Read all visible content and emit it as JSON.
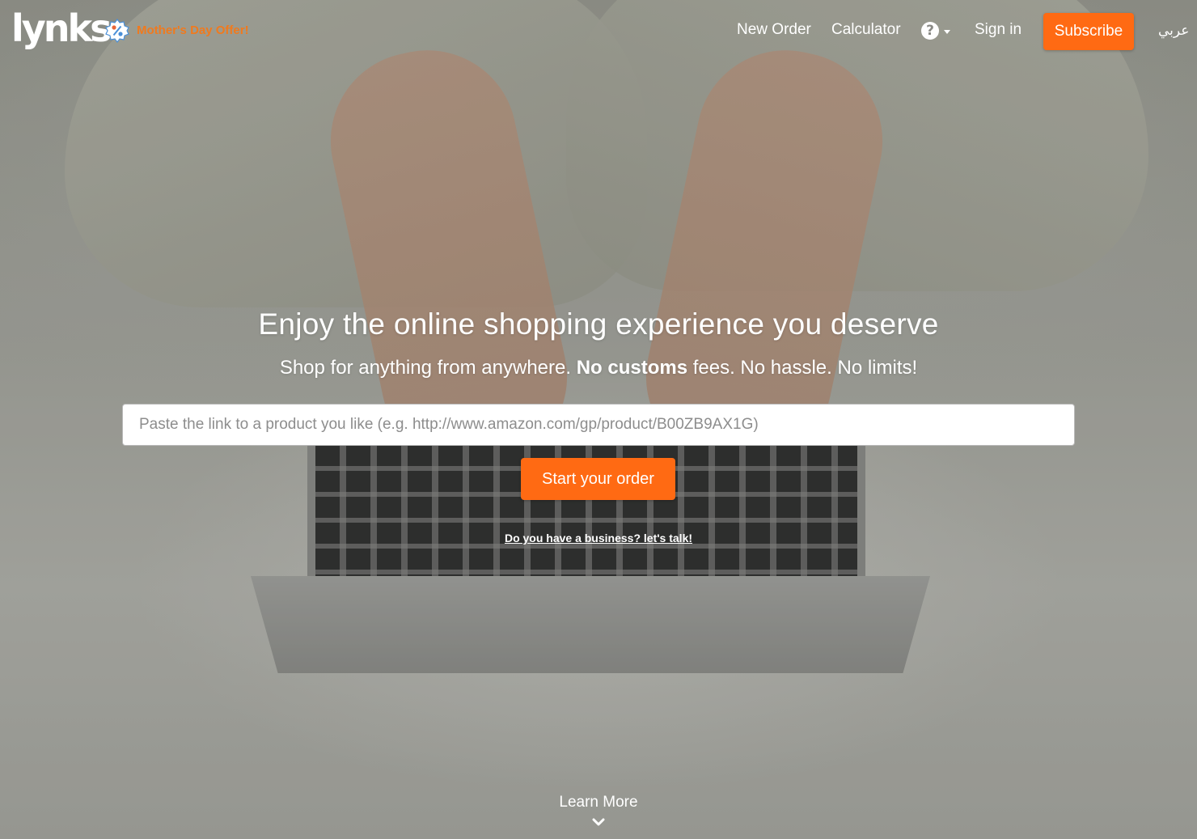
{
  "header": {
    "logo": "lynks",
    "offer_text": "Mother's Day Offer!",
    "offer_icon": "discount-badge-icon",
    "nav": {
      "new_order": "New Order",
      "calculator": "Calculator",
      "help_icon": "question-circle-icon",
      "sign_in": "Sign in",
      "subscribe": "Subscribe",
      "language": "عربي"
    }
  },
  "hero": {
    "headline": "Enjoy the online shopping experience you deserve",
    "subline_part1": "Shop for anything from anywhere. ",
    "subline_bold": "No customs",
    "subline_part2": " fees. No hassle. No limits!",
    "input_placeholder": "Paste the link to a product you like (e.g. http://www.amazon.com/gp/product/B00ZB9AX1G)",
    "input_value": "",
    "start_button": "Start your order",
    "business_link": "Do you have a business? let's talk!",
    "learn_more": "Learn More",
    "learn_more_icon": "chevron-down-icon"
  },
  "colors": {
    "accent": "#ff6a13",
    "offer": "#f07a1e",
    "text_light": "#ffffff"
  }
}
